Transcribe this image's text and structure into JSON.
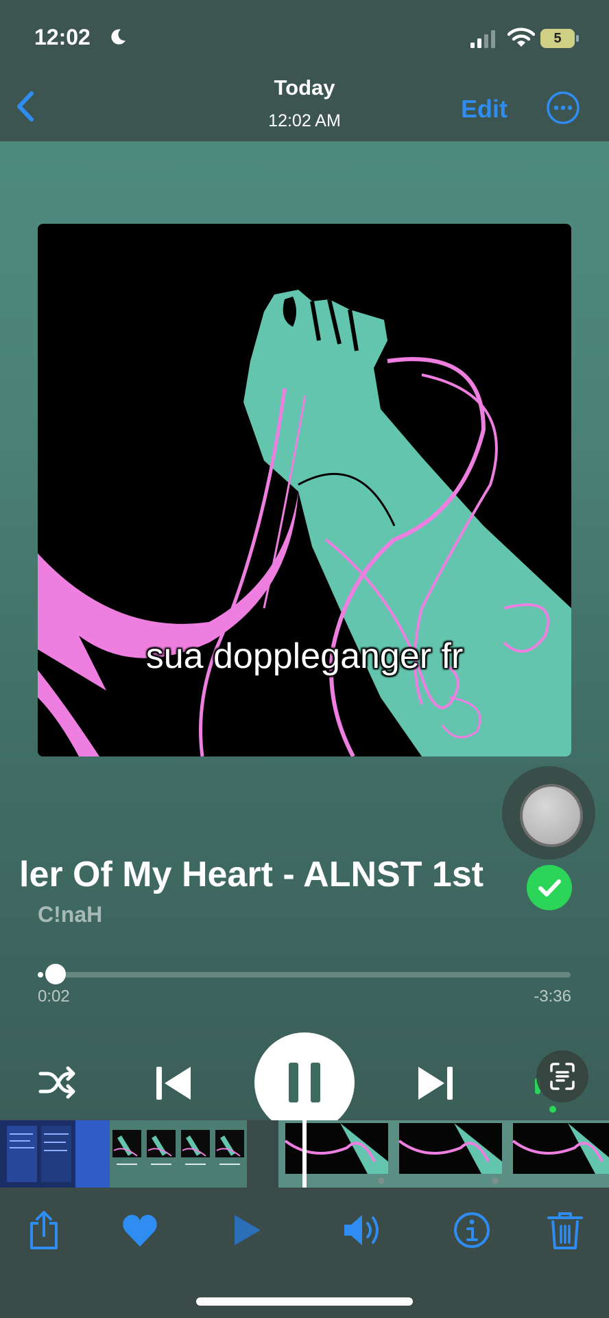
{
  "status_bar": {
    "time": "12:02",
    "battery": "5"
  },
  "nav": {
    "title": "Today",
    "subtitle": "12:02 AM",
    "edit_label": "Edit"
  },
  "artwork": {
    "caption": "sua doppleganger fr"
  },
  "now_playing": {
    "title": "ler Of My Heart - ALNST 1st A",
    "artist": "C!naH",
    "elapsed": "0:02",
    "remaining": "-3:36",
    "progress_fraction": 0.01
  },
  "colors": {
    "accent": "#2f8cf0",
    "check": "#2bd558",
    "art_teal": "#64c5ae",
    "art_pink": "#ee7fe0"
  },
  "icons": {
    "status": [
      "moon-icon",
      "signal-icon",
      "wifi-icon",
      "battery-icon"
    ],
    "nav": [
      "chevron-left-icon",
      "more-icon"
    ],
    "controls": [
      "shuffle-icon",
      "previous-icon",
      "pause-icon",
      "next-icon",
      "scan-text-icon"
    ],
    "toolbar": [
      "share-icon",
      "heart-icon",
      "play-icon",
      "speaker-icon",
      "info-icon",
      "trash-icon"
    ]
  }
}
